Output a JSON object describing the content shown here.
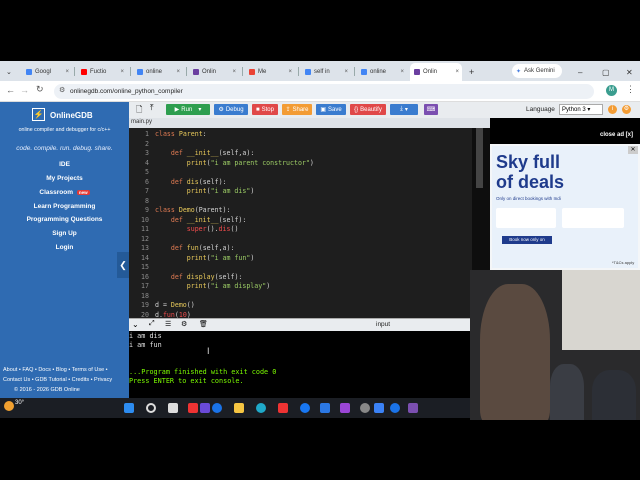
{
  "browser": {
    "tabs": [
      {
        "label": "Googl"
      },
      {
        "label": "Fuctio"
      },
      {
        "label": "online"
      },
      {
        "label": "Onlin"
      },
      {
        "label": "Me"
      },
      {
        "label": "self in"
      },
      {
        "label": "online"
      },
      {
        "label": "Onlin"
      }
    ],
    "new_tab": "+",
    "gemini": "Ask Gemini",
    "url": "onlinegdb.com/online_python_compiler",
    "profile_initial": "M",
    "win_controls": [
      "–",
      "▢",
      "✕"
    ]
  },
  "sidebar": {
    "brand": "OnlineGDB",
    "brand_sub": "online compiler and debugger for c/c++",
    "tagline": "code. compile. run. debug. share.",
    "items": [
      {
        "label": "IDE"
      },
      {
        "label": "My Projects"
      },
      {
        "label": "Classroom"
      },
      {
        "label": "Learn Programming"
      },
      {
        "label": "Programming Questions"
      },
      {
        "label": "Sign Up"
      },
      {
        "label": "Login"
      }
    ],
    "new_badge": "new",
    "collapse": "❮",
    "footer": [
      "About • FAQ • Docs • Blog • Terms of Use •",
      "Contact Us • GDB Tutorial • Credits • Privacy",
      "© 2016 - 2026 GDB Online"
    ]
  },
  "toolbar": {
    "run": "Run",
    "debug": "Debug",
    "stop": "Stop",
    "share": "Share",
    "save": "Save",
    "beautify": "Beautify",
    "language_label": "Language",
    "language_value": "Python 3"
  },
  "file_tab": "main.py",
  "editor": {
    "lines": [
      {
        "n": "1",
        "html": "<span class='kw'>class</span> <span class='fn'>Parent</span>:"
      },
      {
        "n": "2",
        "html": ""
      },
      {
        "n": "3",
        "html": "    <span class='kw'>def</span> <span class='fn'>__init__</span>(self,a):"
      },
      {
        "n": "4",
        "html": "        <span class='fn'>print</span>(<span class='st'>\"i am parent constructor\"</span>)"
      },
      {
        "n": "5",
        "html": ""
      },
      {
        "n": "6",
        "html": "    <span class='kw'>def</span> <span class='fn'>dis</span>(self):"
      },
      {
        "n": "7",
        "html": "        <span class='fn'>print</span>(<span class='st'>\"i am dis\"</span>)"
      },
      {
        "n": "8",
        "html": ""
      },
      {
        "n": "9",
        "html": "<span class='kw'>class</span> <span class='fn'>Demo</span>(Parent):"
      },
      {
        "n": "10",
        "html": "    <span class='kw'>def</span> <span class='fn'>__init__</span>(self):"
      },
      {
        "n": "11",
        "html": "        <span class='ex'>super</span>().<span class='ex'>dis</span>()"
      },
      {
        "n": "12",
        "html": ""
      },
      {
        "n": "13",
        "html": "    <span class='kw'>def</span> <span class='fn'>fun</span>(self,a):"
      },
      {
        "n": "14",
        "html": "        <span class='fn'>print</span>(<span class='st'>\"i am fun\"</span>)"
      },
      {
        "n": "15",
        "html": ""
      },
      {
        "n": "16",
        "html": "    <span class='kw'>def</span> <span class='fn'>display</span>(self):"
      },
      {
        "n": "17",
        "html": "        <span class='fn'>print</span>(<span class='st'>\"i am display\"</span>)"
      },
      {
        "n": "18",
        "html": ""
      },
      {
        "n": "19",
        "html": "d = <span class='fn'>Demo</span>()"
      },
      {
        "n": "20",
        "html": "d.<span class='ex'>fun</span>(<span class='ex'>10</span>)"
      }
    ]
  },
  "ad": {
    "close": "close ad [x]",
    "headline1": "Sky full",
    "headline2": "of deals",
    "sub": "Only on direct bookings with Indi",
    "cta": "Book now only on",
    "tcs": "*T&Cs apply"
  },
  "console": {
    "input_label": "input",
    "output": [
      {
        "text": "i am dis",
        "color": "#e0e0e0"
      },
      {
        "text": "i am fun",
        "color": "#e0e0e0"
      },
      {
        "text": "",
        "color": "#e0e0e0"
      },
      {
        "text": "",
        "color": "#e0e0e0"
      },
      {
        "text": "...Program finished with exit code 0",
        "color": "#7cfc00"
      },
      {
        "text": "Press ENTER to exit console.",
        "color": "#7cfc00"
      }
    ]
  },
  "taskbar": {
    "weather": "30°"
  },
  "colors": {
    "sidebar": "#2f6bb2",
    "run": "#2e9e4f",
    "debug": "#3a7ccf",
    "stop": "#e04848",
    "share": "#f39c34",
    "save": "#3a7ccf",
    "beautify": "#e04848"
  }
}
